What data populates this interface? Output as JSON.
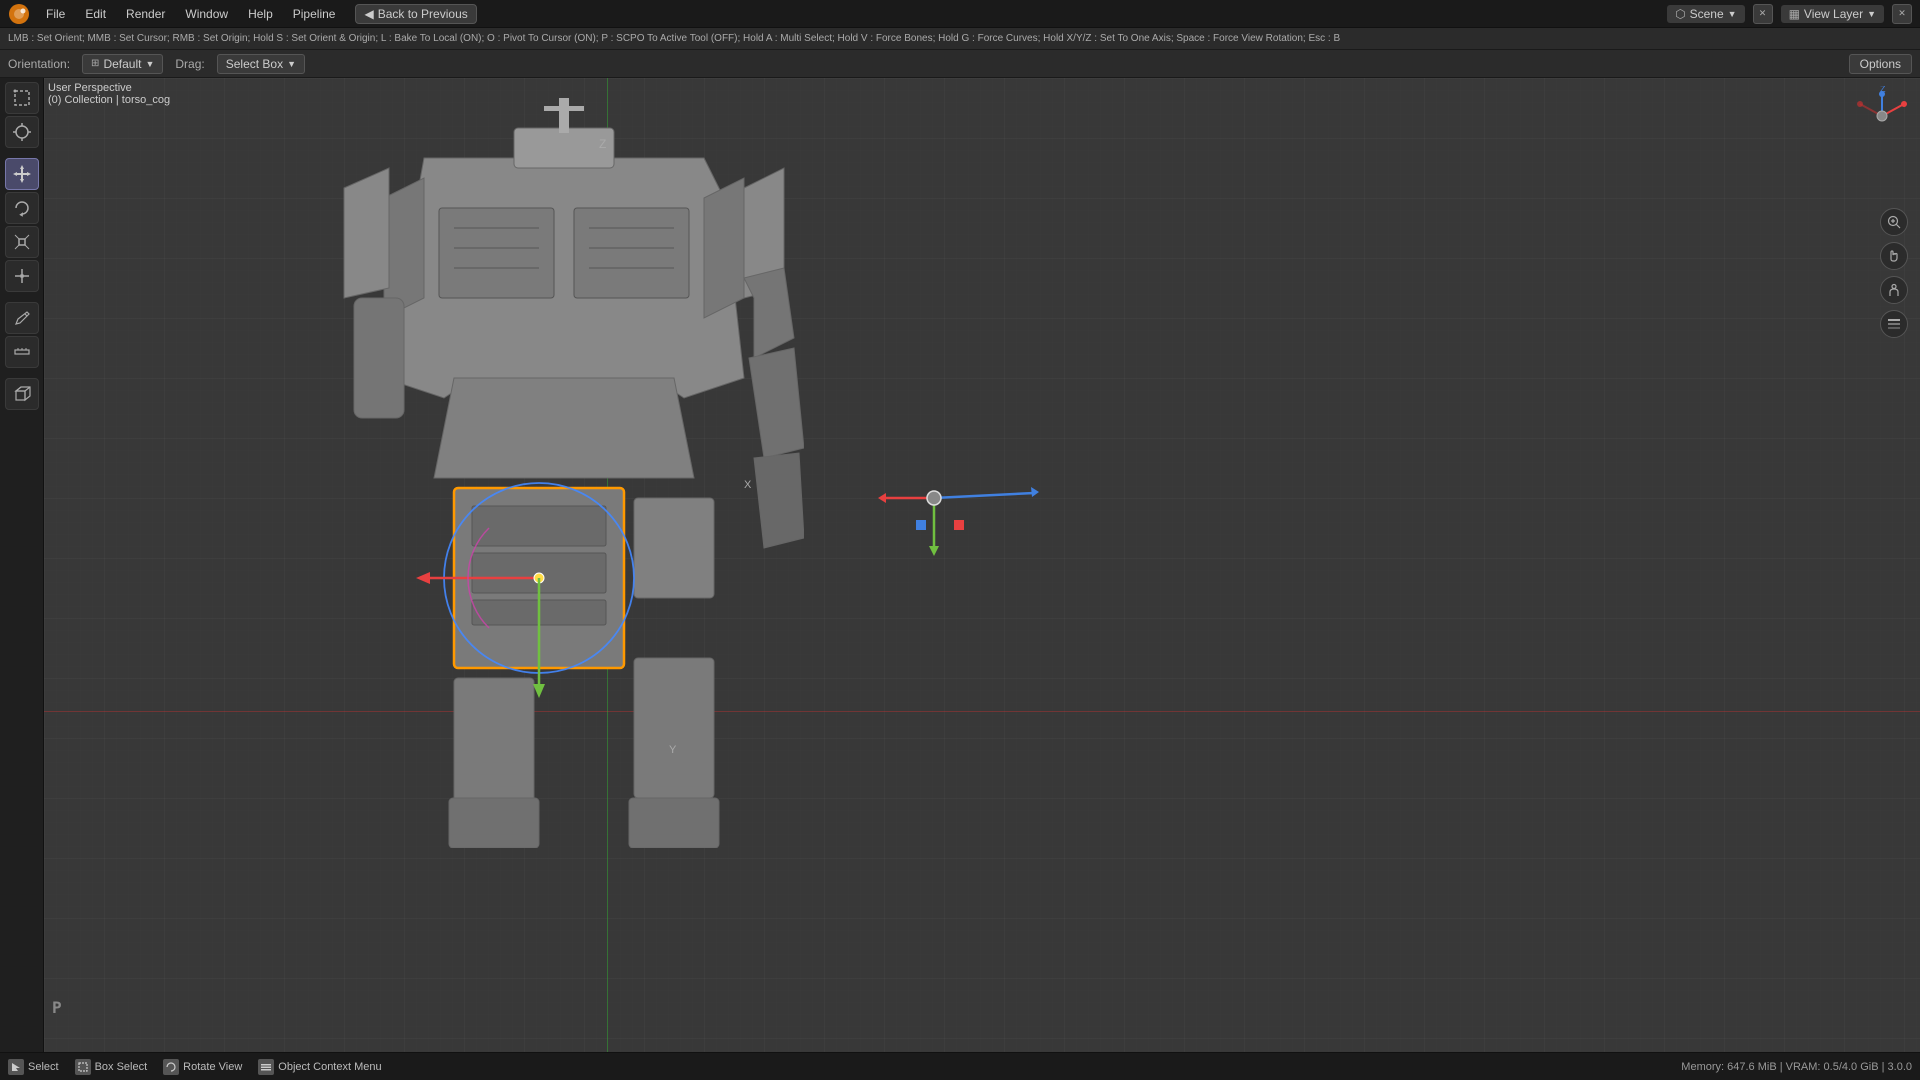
{
  "app": {
    "title": "Blender"
  },
  "topMenu": {
    "items": [
      "File",
      "Edit",
      "Render",
      "Window",
      "Help",
      "Pipeline"
    ],
    "backToPrev": "Back to Previous",
    "scene": {
      "icon": "⬡",
      "label": "Scene"
    },
    "viewLayer": {
      "icon": "▦",
      "label": "View Layer"
    },
    "closeIcon": "✕",
    "maxIcon": "□"
  },
  "shortcutBar": {
    "text": "LMB : Set Orient;  MMB : Set Cursor;  RMB : Set Origin;  Hold S : Set Orient & Origin;  L : Bake To Local (ON);  O : Pivot To Cursor (ON);  P : SCPO To Active Tool (OFF);  Hold A : Multi Select;  Hold V : Force Bones;  Hold G : Force Curves;  Hold X/Y/Z : Set To One Axis;  Space : Force View Rotation;  Esc : B"
  },
  "toolbar": {
    "orientationLabel": "Orientation:",
    "orientationValue": "Default",
    "dragLabel": "Drag:",
    "dragValue": "Select Box",
    "optionsLabel": "Options"
  },
  "viewport": {
    "perspectiveLabel": "User Perspective",
    "collectionLabel": "(0) Collection | torso_cog"
  },
  "leftTools": [
    {
      "icon": "⊞",
      "name": "select-box-tool",
      "active": false
    },
    {
      "icon": "⊙",
      "name": "cursor-tool",
      "active": false
    },
    {
      "icon": "↔",
      "name": "move-tool",
      "active": true
    },
    {
      "icon": "↻",
      "name": "rotate-tool",
      "active": false
    },
    {
      "icon": "⊡",
      "name": "scale-tool",
      "active": false
    },
    {
      "icon": "⊕",
      "name": "transform-tool",
      "active": false
    },
    {
      "icon": "✏",
      "name": "annotate-tool",
      "active": false
    },
    {
      "icon": "□",
      "name": "measure-tool",
      "active": false
    },
    {
      "icon": "◧",
      "name": "add-cube-tool",
      "active": false
    }
  ],
  "statusBar": {
    "selectLabel": "Select",
    "boxSelectLabel": "Box Select",
    "rotateViewLabel": "Rotate View",
    "contextMenuLabel": "Object Context Menu",
    "memory": "Memory: 647.6 MiB | VRAM: 0.5/4.0 GiB | 3.0.0"
  },
  "pKey": "P",
  "colors": {
    "selectOrange": "#ff9900",
    "axisX": "#e84040",
    "axisY": "#70c040",
    "axisZ": "#4080e0",
    "gizmoRed": "#e84040",
    "gizmoGreen": "#70c040",
    "gizmoBlue": "#4080e0"
  }
}
